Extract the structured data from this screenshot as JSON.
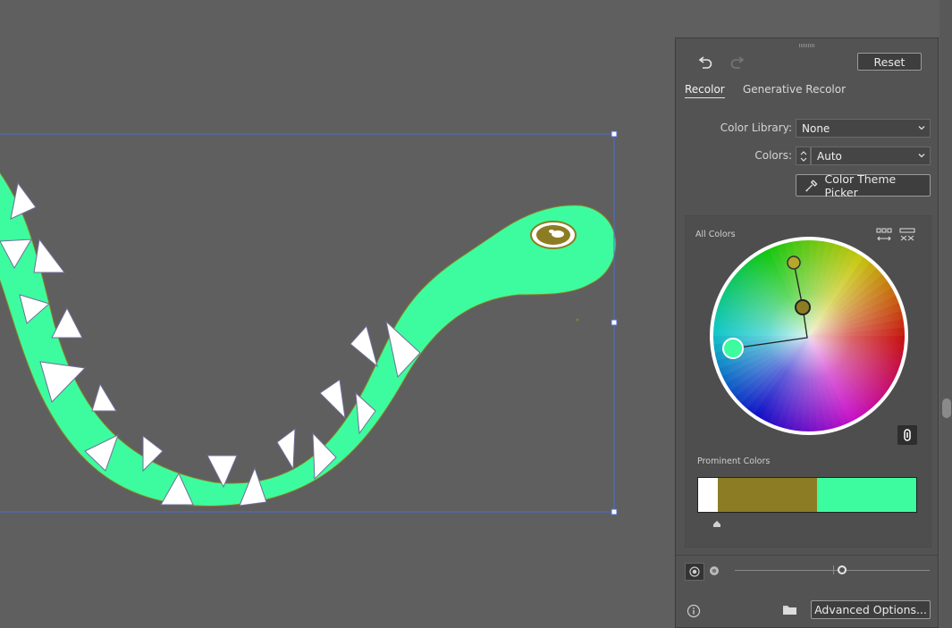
{
  "panel": {
    "undo_icon": "undo-icon",
    "redo_icon": "redo-icon",
    "reset_label": "Reset",
    "tabs": [
      {
        "label": "Recolor",
        "active": true
      },
      {
        "label": "Generative Recolor",
        "active": false
      }
    ],
    "color_library": {
      "label": "Color Library:",
      "value": "None"
    },
    "colors": {
      "label": "Colors:",
      "value": "Auto"
    },
    "theme_picker_label": "Color Theme Picker",
    "all_colors_label": "All Colors",
    "prominent_colors_label": "Prominent Colors",
    "prominent_colors": [
      {
        "color": "#ffffff",
        "share": 0.09
      },
      {
        "color": "#8c7d24",
        "share": 0.455
      },
      {
        "color": "#3dfc9f",
        "share": 0.455
      }
    ],
    "wheel_handles": [
      {
        "color": "#3dfc9f",
        "role": "base"
      },
      {
        "color": "#b5a72b"
      },
      {
        "color": "#8c7d24"
      }
    ],
    "saturation_level": 0.55,
    "advanced_options_label": "Advanced Options..."
  },
  "colors": {
    "canvas_bg": "#5f5f5f",
    "panel_bg": "#535353",
    "snake_green": "#3dfc9f",
    "eye_olive": "#8c7d24",
    "selection_blue": "#4d6bd6"
  }
}
